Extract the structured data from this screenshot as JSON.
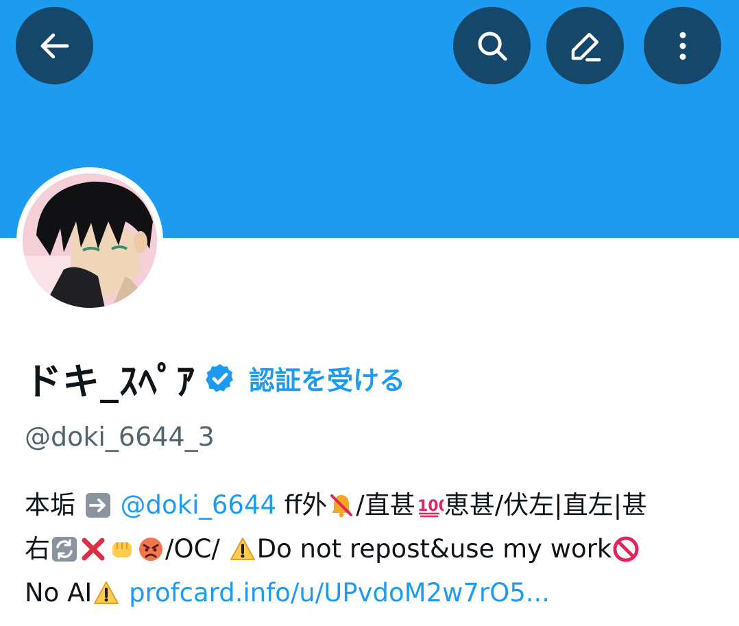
{
  "header": {
    "back_icon": "arrow-left-icon",
    "search_icon": "search-icon",
    "edit_icon": "pencil-icon",
    "more_icon": "more-vertical-icon",
    "banner_color": "#1d9bf0",
    "button_color": "#15476b"
  },
  "profile": {
    "display_name": "ドキ_ｽﾍﾟｱ",
    "verified_icon": "verified-badge-icon",
    "get_verified_label": "認証を受ける",
    "handle": "@doki_6644_3",
    "bio": {
      "line1": {
        "prefix": "本垢",
        "mention": "@doki_6644",
        "text1": " ff外",
        "text2": "/直甚",
        "text3": "恵甚/伏左|直左|甚"
      },
      "line2": {
        "text1": "右",
        "text2": "/OC/ ",
        "text3": "Do not repost&use my work"
      },
      "line3": {
        "text1": "No AI",
        "link": "profcard.info/u/UPvdoM2w7rO5..."
      }
    }
  },
  "colors": {
    "link": "#1d9bf0",
    "handle": "#536471",
    "text": "#0f1419"
  }
}
